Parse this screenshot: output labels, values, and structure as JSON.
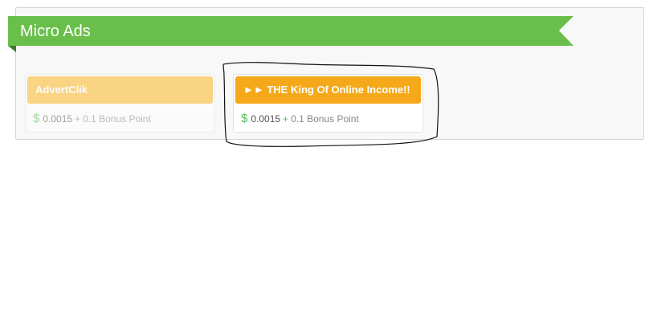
{
  "section": {
    "title": "Micro Ads",
    "ribbon_color": "#6abf4b"
  },
  "ads": [
    {
      "title": "AdvertClik",
      "currency_symbol": "$",
      "amount": "0.0015",
      "plus": "+",
      "bonus": "0.1 Bonus Point",
      "state": "visited"
    },
    {
      "title": "►► THE King Of Online Income!!",
      "currency_symbol": "$",
      "amount": "0.0015",
      "plus": "+",
      "bonus": "0.1 Bonus Point",
      "state": "active"
    }
  ],
  "colors": {
    "ad_button": "#f5a91a",
    "money_green": "#5cb85c"
  }
}
